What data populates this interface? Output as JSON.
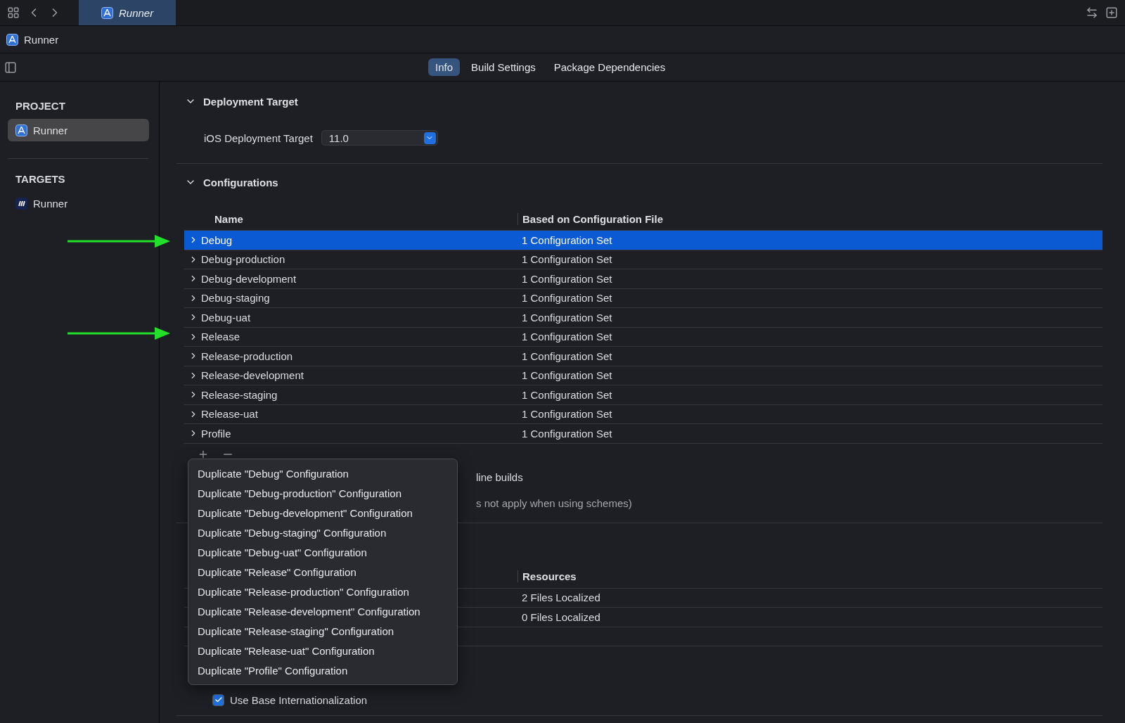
{
  "window": {
    "tab_title": "Runner"
  },
  "breadcrumb": {
    "label": "Runner"
  },
  "tabs": [
    {
      "label": "Info",
      "selected": true
    },
    {
      "label": "Build Settings",
      "selected": false
    },
    {
      "label": "Package Dependencies",
      "selected": false
    }
  ],
  "sidebar": {
    "sections": [
      {
        "heading": "PROJECT",
        "items": [
          {
            "label": "Runner",
            "kind": "project",
            "selected": true
          }
        ]
      },
      {
        "heading": "TARGETS",
        "items": [
          {
            "label": "Runner",
            "kind": "target",
            "selected": false
          }
        ]
      }
    ]
  },
  "deployment": {
    "title": "Deployment Target",
    "expanded": true,
    "label": "iOS Deployment Target",
    "value": "11.0"
  },
  "configurations": {
    "title": "Configurations",
    "expanded": true,
    "columns": [
      "Name",
      "Based on Configuration File"
    ],
    "rows": [
      {
        "name": "Debug",
        "file": "1 Configuration Set",
        "selected": true,
        "expanded": false
      },
      {
        "name": "Debug-production",
        "file": "1 Configuration Set",
        "selected": false,
        "expanded": false
      },
      {
        "name": "Debug-development",
        "file": "1 Configuration Set",
        "selected": false,
        "expanded": false
      },
      {
        "name": "Debug-staging",
        "file": "1 Configuration Set",
        "selected": false,
        "expanded": false
      },
      {
        "name": "Debug-uat",
        "file": "1 Configuration Set",
        "selected": false,
        "expanded": false
      },
      {
        "name": "Release",
        "file": "1 Configuration Set",
        "selected": false,
        "expanded": false
      },
      {
        "name": "Release-production",
        "file": "1 Configuration Set",
        "selected": false,
        "expanded": false
      },
      {
        "name": "Release-development",
        "file": "1 Configuration Set",
        "selected": false,
        "expanded": false
      },
      {
        "name": "Release-staging",
        "file": "1 Configuration Set",
        "selected": false,
        "expanded": false
      },
      {
        "name": "Release-uat",
        "file": "1 Configuration Set",
        "selected": false,
        "expanded": false
      },
      {
        "name": "Profile",
        "file": "1 Configuration Set",
        "selected": false,
        "expanded": false
      }
    ],
    "notes": [
      "line builds",
      "s not apply when using schemes)"
    ]
  },
  "localizations": {
    "columns": [
      "Resources"
    ],
    "rows": [
      {
        "resources": "2 Files Localized"
      },
      {
        "resources": "0 Files Localized"
      }
    ],
    "use_base": {
      "label": "Use Base Internationalization",
      "checked": true
    }
  },
  "menu": {
    "items": [
      "Duplicate \"Debug\" Configuration",
      "Duplicate \"Debug-production\" Configuration",
      "Duplicate \"Debug-development\" Configuration",
      "Duplicate \"Debug-staging\" Configuration",
      "Duplicate \"Debug-uat\" Configuration",
      "Duplicate \"Release\" Configuration",
      "Duplicate \"Release-production\" Configuration",
      "Duplicate \"Release-development\" Configuration",
      "Duplicate \"Release-staging\" Configuration",
      "Duplicate \"Release-uat\" Configuration",
      "Duplicate \"Profile\" Configuration"
    ]
  }
}
